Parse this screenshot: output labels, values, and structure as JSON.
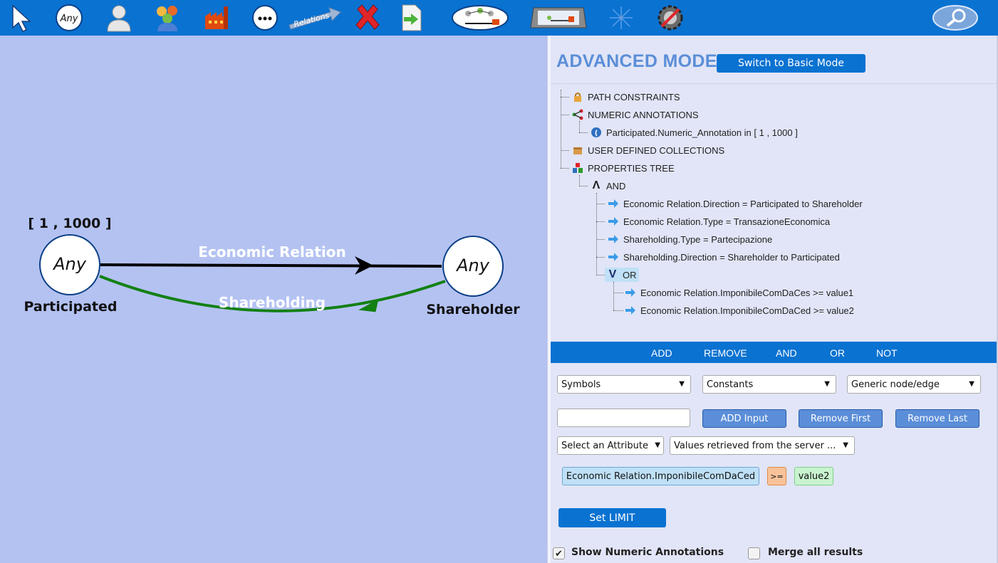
{
  "toolbar": {
    "any_label": "Any",
    "relations_label": "Relations",
    "items": [
      "pointer-icon",
      "any-node-icon",
      "person-icon",
      "group-icon",
      "factory-icon",
      "more-icon",
      "relations-icon",
      "delete-icon",
      "export-icon",
      "graph-icon",
      "screen-icon",
      "network-icon",
      "settings-icon",
      "search-icon"
    ]
  },
  "graph": {
    "constraint": "[ 1 , 1000 ]",
    "node_left": {
      "text": "Any",
      "label": "Participated"
    },
    "node_right": {
      "text": "Any",
      "label": "Shareholder"
    },
    "edge_top": {
      "label": "Economic Relation",
      "color": "#000000"
    },
    "edge_bottom": {
      "label": "Shareholding",
      "color": "#138013"
    }
  },
  "panel": {
    "mode_title": "ADVANCED MODE",
    "switch_button": "Switch to Basic Mode",
    "tree": {
      "path_constraints": "PATH CONSTRAINTS",
      "numeric_annotations": "NUMERIC ANNOTATIONS",
      "numeric_item": "Participated.Numeric_Annotation in [ 1 , 1000 ]",
      "user_collections": "USER DEFINED COLLECTIONS",
      "properties_tree": "PROPERTIES TREE",
      "and_label": "AND",
      "and_symbol": "Λ",
      "and_items": [
        "Economic Relation.Direction = Participated to Shareholder",
        "Economic Relation.Type = TransazioneEconomica",
        "Shareholding.Type = Partecipazione",
        "Shareholding.Direction = Shareholder to Participated"
      ],
      "or_label": "OR",
      "or_symbol": "V",
      "or_items": [
        "Economic Relation.ImponibileComDaCes >= value1",
        "Economic Relation.ImponibileComDaCed >= value2"
      ]
    },
    "actions": {
      "add": "ADD",
      "remove": "REMOVE",
      "and": "AND",
      "or": "OR",
      "not": "NOT"
    },
    "selects": {
      "symbols": "Symbols",
      "constants": "Constants",
      "generic": "Generic node/edge",
      "attribute": "Select an Attribute",
      "values": "Values retrieved from the server ..."
    },
    "buttons": {
      "add_input": "ADD Input",
      "remove_first": "Remove First",
      "remove_last": "Remove Last",
      "set_limit": "Set LIMIT"
    },
    "input_value": "",
    "expression": {
      "attribute": "Economic Relation.ImponibileComDaCed",
      "operator": ">=",
      "value": "value2"
    },
    "checkboxes": {
      "show_numeric": {
        "label": "Show Numeric Annotations",
        "checked": true
      },
      "merge_results": {
        "label": "Merge all results",
        "checked": false
      }
    }
  },
  "colors": {
    "accent": "#0a72d1",
    "canvas_bg": "#b4c2f2",
    "panel_bg": "#e1e5f7",
    "mode_title": "#5b8ed8"
  }
}
